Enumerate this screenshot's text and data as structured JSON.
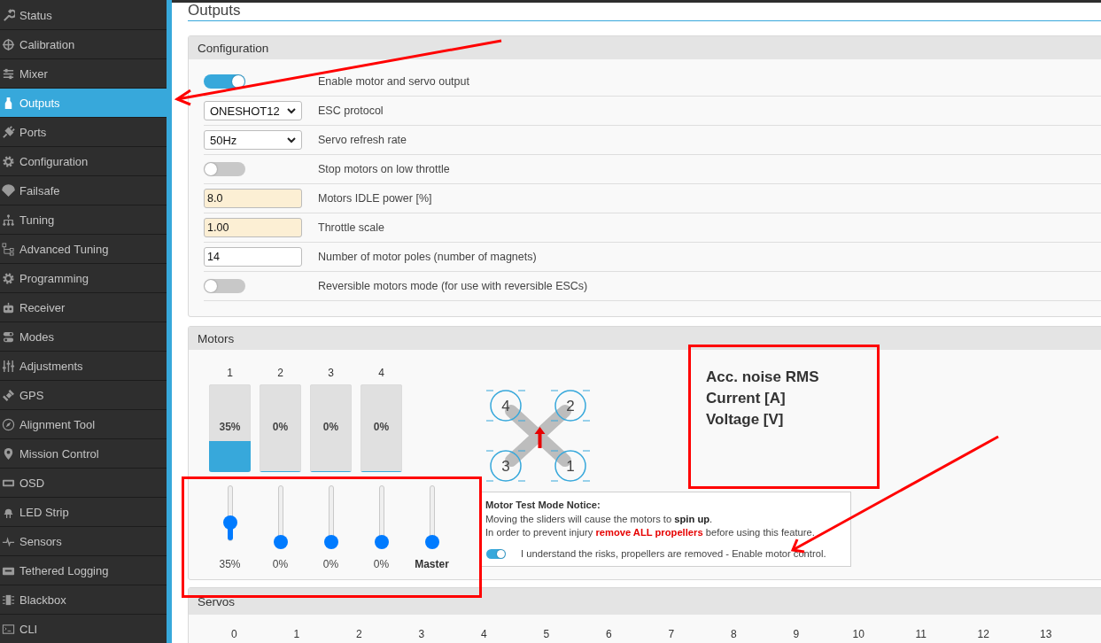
{
  "sidebar": {
    "items": [
      {
        "label": "Status",
        "selected": false
      },
      {
        "label": "Calibration",
        "selected": false
      },
      {
        "label": "Mixer",
        "selected": false
      },
      {
        "label": "Outputs",
        "selected": true
      },
      {
        "label": "Ports",
        "selected": false
      },
      {
        "label": "Configuration",
        "selected": false
      },
      {
        "label": "Failsafe",
        "selected": false
      },
      {
        "label": "Tuning",
        "selected": false
      },
      {
        "label": "Advanced Tuning",
        "selected": false
      },
      {
        "label": "Programming",
        "selected": false
      },
      {
        "label": "Receiver",
        "selected": false
      },
      {
        "label": "Modes",
        "selected": false
      },
      {
        "label": "Adjustments",
        "selected": false
      },
      {
        "label": "GPS",
        "selected": false
      },
      {
        "label": "Alignment Tool",
        "selected": false
      },
      {
        "label": "Mission Control",
        "selected": false
      },
      {
        "label": "OSD",
        "selected": false
      },
      {
        "label": "LED Strip",
        "selected": false
      },
      {
        "label": "Sensors",
        "selected": false
      },
      {
        "label": "Tethered Logging",
        "selected": false
      },
      {
        "label": "Blackbox",
        "selected": false
      },
      {
        "label": "CLI",
        "selected": false
      }
    ]
  },
  "page_title": "Outputs",
  "configuration": {
    "title": "Configuration",
    "rows": [
      {
        "kind": "toggle",
        "on": true,
        "label": "Enable motor and servo output"
      },
      {
        "kind": "select",
        "value": "ONESHOT12",
        "label": "ESC protocol"
      },
      {
        "kind": "select",
        "value": "50Hz",
        "label": "Servo refresh rate"
      },
      {
        "kind": "toggle",
        "on": false,
        "label": "Stop motors on low throttle"
      },
      {
        "kind": "input",
        "value": "8.0",
        "highlighted": true,
        "label": "Motors IDLE power [%]"
      },
      {
        "kind": "input",
        "value": "1.00",
        "highlighted": true,
        "label": "Throttle scale"
      },
      {
        "kind": "input",
        "value": "14",
        "highlighted": false,
        "label": "Number of motor poles (number of magnets)"
      },
      {
        "kind": "toggle",
        "on": false,
        "label": "Reversible motors mode (for use with reversible ESCs)"
      }
    ]
  },
  "motors": {
    "title": "Motors",
    "outputs": [
      {
        "number": "1",
        "level": 0.35,
        "reading": "35%"
      },
      {
        "number": "2",
        "level": 0,
        "reading": "0%"
      },
      {
        "number": "3",
        "level": 0,
        "reading": "0%"
      },
      {
        "number": "4",
        "level": 0,
        "reading": "0%"
      }
    ],
    "sliders": [
      {
        "kind": "motor",
        "level": 0.35,
        "label": "35%"
      },
      {
        "kind": "motor",
        "level": 0,
        "label": "0%"
      },
      {
        "kind": "motor",
        "level": 0,
        "label": "0%"
      },
      {
        "kind": "motor",
        "level": 0,
        "label": "0%"
      },
      {
        "kind": "master",
        "level": 0,
        "label": "Master"
      }
    ],
    "diagram_motors": [
      "4",
      "2",
      "3",
      "1"
    ],
    "readouts": [
      "Acc. noise RMS",
      "Current [A]",
      "Voltage [V]"
    ],
    "notice": {
      "title": "Motor Test Mode Notice:",
      "lines": [
        {
          "kind": "info",
          "text": "Moving the sliders will cause the motors to **spin up**."
        },
        {
          "kind": "warning",
          "text": "In order to prevent injury **remove ALL propellers** before using this feature."
        }
      ],
      "confirm": {
        "on": true,
        "label": "I understand the risks, propellers are removed - Enable motor control."
      }
    }
  },
  "servos": {
    "title": "Servos",
    "columns": [
      "0",
      "1",
      "2",
      "3",
      "4",
      "5",
      "6",
      "7",
      "8",
      "9",
      "10",
      "11",
      "12",
      "13"
    ]
  }
}
